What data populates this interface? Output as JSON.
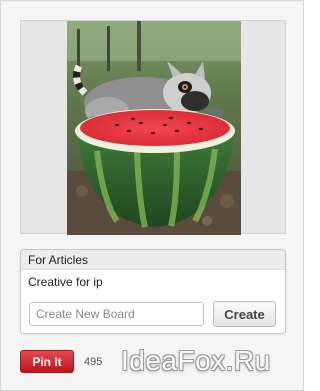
{
  "boards": {
    "items": [
      {
        "label": "For Articles",
        "selected": true
      },
      {
        "label": "Creative for ip",
        "selected": false
      }
    ],
    "create_placeholder": "Create New Board",
    "create_button_label": "Create"
  },
  "pin": {
    "button_label": "Pin It",
    "count": "495"
  },
  "watermark": "IdeaFox.Ru",
  "image": {
    "description_icon": "lemur-eating-watermelon-photo"
  },
  "colors": {
    "pin_red": "#c8171e",
    "panel_border": "#c8c8c8",
    "selected_row": "#ececec"
  }
}
